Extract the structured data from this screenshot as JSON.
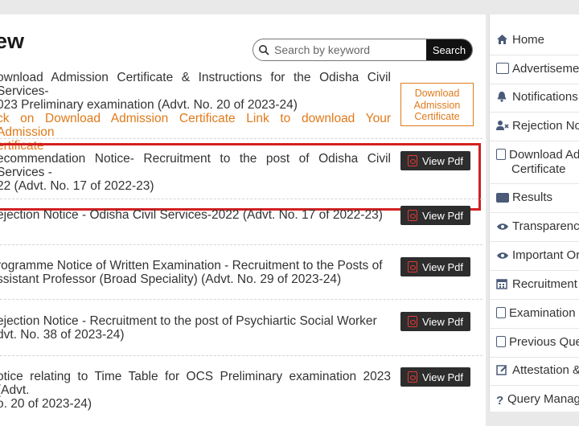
{
  "main": {
    "title": "ew",
    "search": {
      "placeholder": "Search by keyword",
      "button": "Search"
    },
    "notices": [
      {
        "line1": "ownload Admission Certificate & Instructions for the Odisha Civil Services-",
        "line2": "023 Preliminary examination (Advt. No. 20 of 2023-24)",
        "sub1": "ck on Download Admission Certificate Link to download Your Admission",
        "sub2": "ertificate",
        "button": "Download Admission Certificate"
      },
      {
        "line1": "ecommendation Notice- Recruitment to the post of Odisha Civil Services -",
        "line2": "22 (Advt. No. 17 of 2022-23)",
        "button": "View Pdf"
      },
      {
        "line1": "ejection Notice - Odisha Civil Services-2022 (Advt. No. 17 of 2022-23)",
        "button": "View Pdf"
      },
      {
        "line1": "rogramme Notice of Written Examination - Recruitment to the Posts of",
        "line2": "ssistant Professor (Broad Speciality) (Advt. No. 29 of 2023-24)",
        "button": "View Pdf"
      },
      {
        "line1": "ejection Notice - Recruitment to the post of Psychiartic Social Worker",
        "line2": "dvt. No. 38 of 2023-24)",
        "button": "View Pdf"
      },
      {
        "line1": "otice relating to Time Table for OCS Preliminary examination 2023 (Advt.",
        "line2": "o. 20 of 2023-24)",
        "button": "View Pdf"
      }
    ]
  },
  "sidebar": {
    "items": [
      {
        "label": "Home",
        "icon": "home-icon"
      },
      {
        "label": "Advertiseme",
        "icon": "newspaper-icon"
      },
      {
        "label": "Notifications",
        "icon": "bell-icon"
      },
      {
        "label": "Rejection No",
        "icon": "user-remove-icon"
      },
      {
        "label": "Download Ad",
        "label2": "Certificate",
        "icon": "file-icon"
      },
      {
        "label": "Results",
        "icon": "id-card-icon"
      },
      {
        "label": "Transparenc",
        "icon": "eye-icon"
      },
      {
        "label": "Important Or",
        "icon": "eye-icon"
      },
      {
        "label": "Recruitment",
        "icon": "calendar-icon"
      },
      {
        "label": "Examination",
        "icon": "file-icon"
      },
      {
        "label": "Previous Que",
        "icon": "file-icon"
      },
      {
        "label": "Attestation &",
        "icon": "edit-icon"
      },
      {
        "label": "Query Manag",
        "icon": "question-icon"
      }
    ]
  },
  "colors": {
    "accent_orange": "#e07a1a",
    "highlight_red": "#d32020",
    "button_dark": "#2d2d2d",
    "icon_blue": "#4a5a78"
  }
}
